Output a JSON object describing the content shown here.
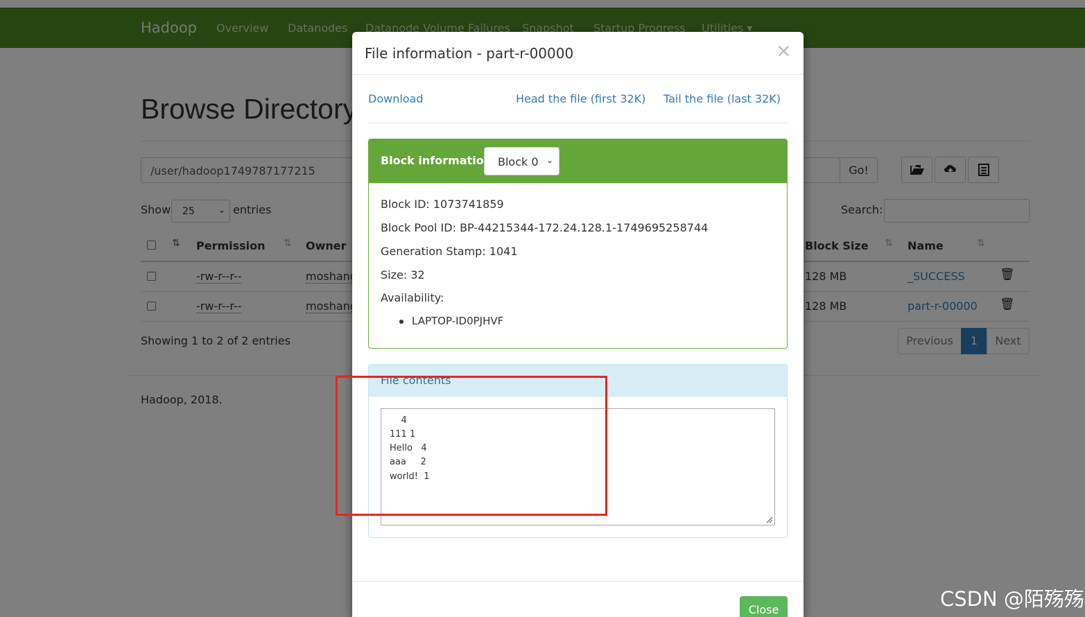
{
  "navbar": {
    "brand": "Hadoop",
    "items": [
      "Overview",
      "Datanodes",
      "Datanode Volume Failures",
      "Snapshot",
      "Startup Progress",
      "Utilities ▾"
    ]
  },
  "page": {
    "title": "Browse Directory",
    "path": "/user/hadoop1749787177215",
    "go_label": "Go!",
    "show_label": "Show",
    "show_value": "25",
    "entries_label": "entries",
    "search_label": "Search:",
    "columns": [
      "Permission",
      "Owner",
      "Block Size",
      "Name"
    ],
    "rows": [
      {
        "permission": "-rw-r--r--",
        "owner": "moshang",
        "block_size": "128 MB",
        "name": "_SUCCESS"
      },
      {
        "permission": "-rw-r--r--",
        "owner": "moshang",
        "block_size": "128 MB",
        "name": "part-r-00000"
      }
    ],
    "info": "Showing 1 to 2 of 2 entries",
    "pager": {
      "previous": "Previous",
      "current": "1",
      "next": "Next"
    },
    "footer": "Hadoop, 2018."
  },
  "modal": {
    "title": "File information - part-r-00000",
    "close_x": "×",
    "links": {
      "download": "Download",
      "head": "Head the file (first 32K)",
      "tail": "Tail the file (last 32K)"
    },
    "block": {
      "heading": "Block information --",
      "selected": "Block 0",
      "block_id": "Block ID: 1073741859",
      "pool_id": "Block Pool ID: BP-44215344-172.24.128.1-1749695258744",
      "gen_stamp": "Generation Stamp: 1041",
      "size": "Size: 32",
      "availability": "Availability:",
      "hosts": [
        "LAPTOP-ID0PJHVF"
      ]
    },
    "contents": {
      "heading": "File contents",
      "lines": [
        "    4",
        "111 1",
        "Hello   4",
        "aaa     2",
        "world!  1"
      ]
    },
    "close_button": "Close"
  },
  "watermark": "CSDN @陌殇殇",
  "colors": {
    "navbar": "#4e8a25",
    "block_panel": "#65a63a",
    "link": "#337ab7",
    "annotation": "#e8251f",
    "close_button": "#5cb85c"
  }
}
